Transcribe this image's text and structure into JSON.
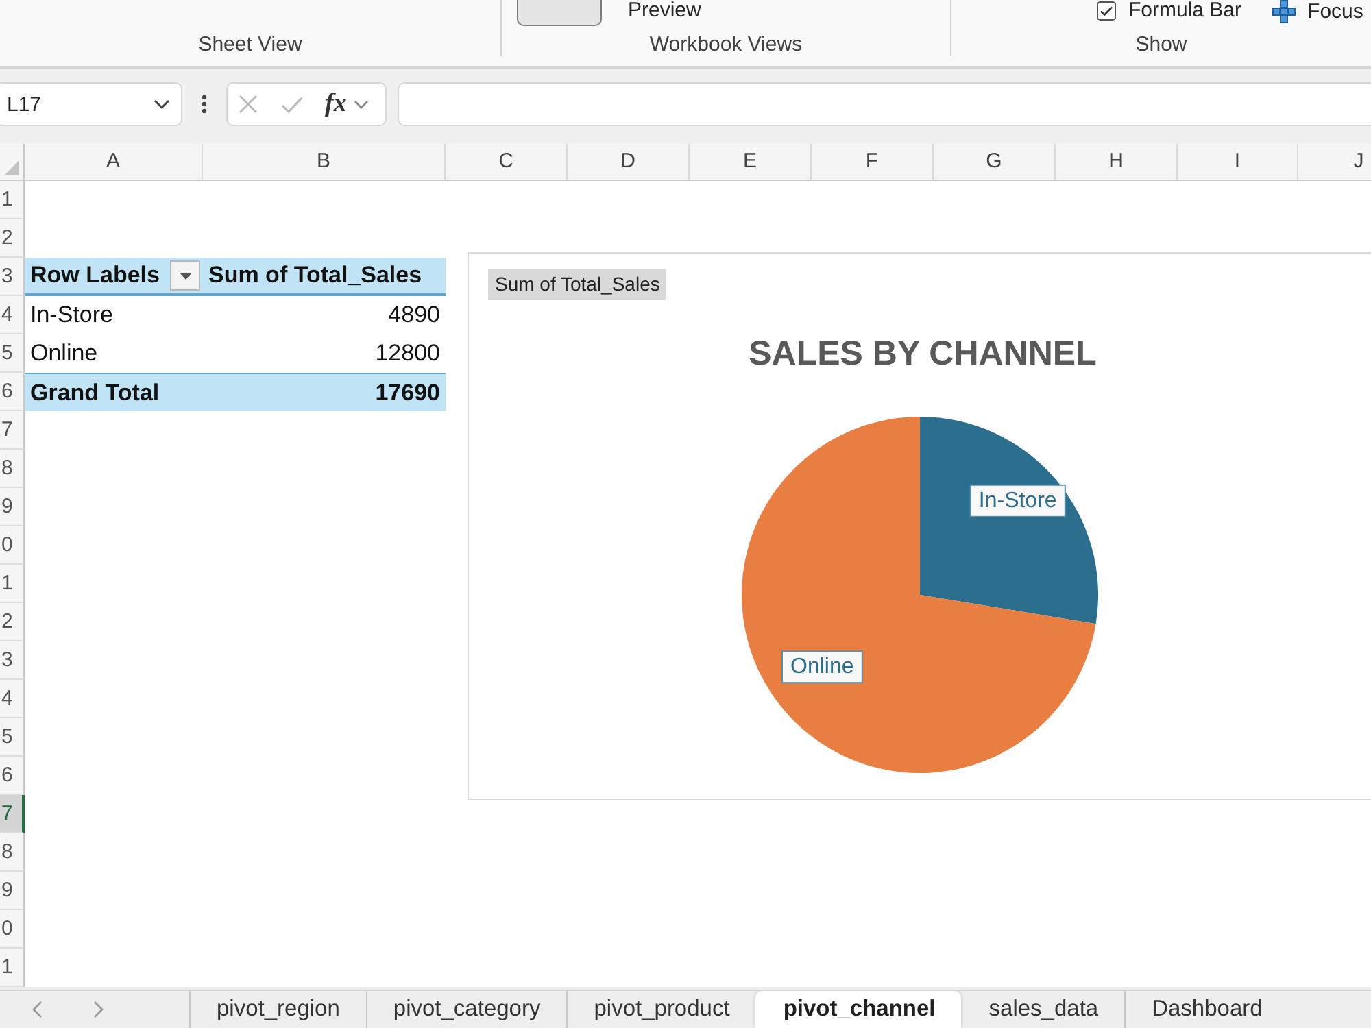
{
  "ribbon": {
    "groups": [
      {
        "label": "Sheet View"
      },
      {
        "label": "Workbook Views",
        "controls": [
          {
            "kind": "view-button",
            "selected": true
          },
          {
            "kind": "button",
            "label": "Preview"
          }
        ]
      },
      {
        "label": "Show",
        "controls": [
          {
            "kind": "checkbox",
            "label": "Formula Bar",
            "checked": true
          },
          {
            "kind": "icon-button",
            "label": "Focus"
          }
        ]
      }
    ]
  },
  "formula_bar": {
    "name_box": "L17",
    "function_label": "fx"
  },
  "sheet": {
    "columns": [
      "A",
      "B",
      "C",
      "D",
      "E",
      "F",
      "G",
      "H",
      "I",
      "J"
    ],
    "rows": [
      {
        "label": "1",
        "selected": false
      },
      {
        "label": "2",
        "selected": false
      },
      {
        "label": "3",
        "selected": false
      },
      {
        "label": "4",
        "selected": false
      },
      {
        "label": "5",
        "selected": false
      },
      {
        "label": "6",
        "selected": false
      },
      {
        "label": "7",
        "selected": false
      },
      {
        "label": "8",
        "selected": false
      },
      {
        "label": "9",
        "selected": false
      },
      {
        "label": "0",
        "selected": false
      },
      {
        "label": "1",
        "selected": false
      },
      {
        "label": "2",
        "selected": false
      },
      {
        "label": "3",
        "selected": false
      },
      {
        "label": "4",
        "selected": false
      },
      {
        "label": "5",
        "selected": false
      },
      {
        "label": "6",
        "selected": false
      },
      {
        "label": "7",
        "selected": true
      },
      {
        "label": "8",
        "selected": false
      },
      {
        "label": "9",
        "selected": false
      },
      {
        "label": "0",
        "selected": false
      },
      {
        "label": "1",
        "selected": false
      }
    ]
  },
  "pivot_table": {
    "columns": [
      "Row Labels",
      "Sum of Total_Sales"
    ],
    "rows": [
      {
        "label": "In-Store",
        "value": "4890"
      },
      {
        "label": "Online",
        "value": "12800"
      }
    ],
    "grand_total": {
      "label": "Grand Total",
      "value": "17690"
    }
  },
  "chart": {
    "chart_data": {
      "type": "pie",
      "title": "SALES BY CHANNEL",
      "categories": [
        "In-Store",
        "Online"
      ],
      "series": [
        {
          "name": "Sum of Total_Sales",
          "colors": [
            "#2c6e8d",
            "#e97e43"
          ],
          "values": [
            27.6,
            72.4
          ]
        }
      ]
    }
  },
  "sheet_tabs": [
    {
      "label": "pivot_region",
      "selected": false
    },
    {
      "label": "pivot_category",
      "selected": false
    },
    {
      "label": "pivot_product",
      "selected": false
    },
    {
      "label": "pivot_channel",
      "selected": true
    },
    {
      "label": "sales_data",
      "selected": false
    },
    {
      "label": "Dashboard",
      "selected": false
    }
  ]
}
